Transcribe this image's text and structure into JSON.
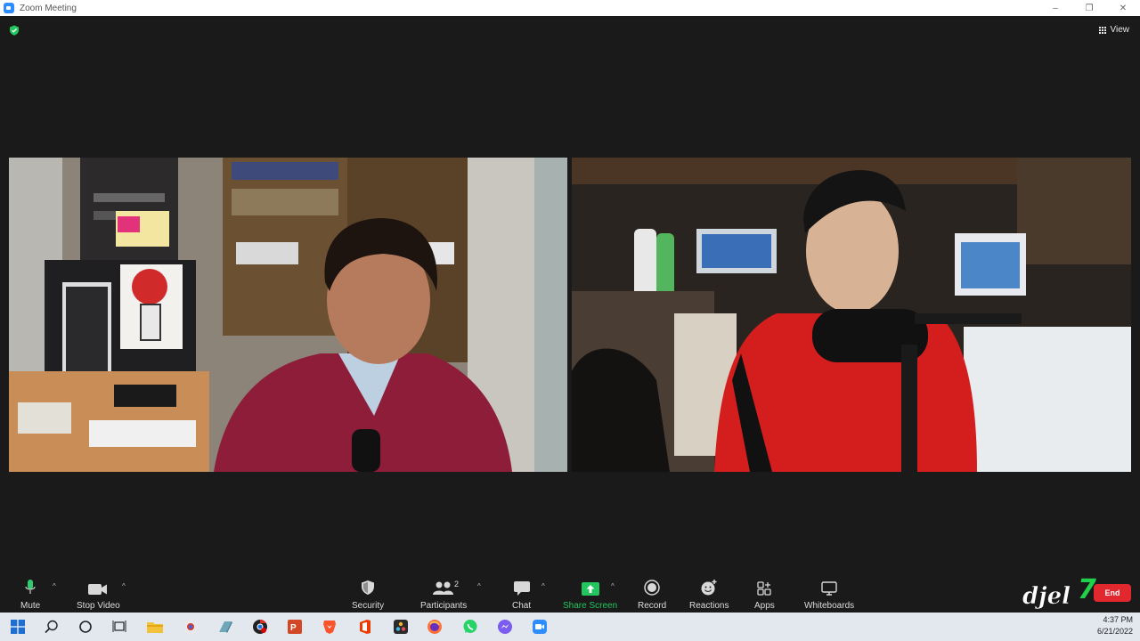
{
  "window": {
    "title": "Zoom Meeting",
    "controls": [
      "–",
      "❐",
      "✕"
    ]
  },
  "meeting": {
    "view_label": "View",
    "encryption": "shield-check-icon"
  },
  "toolbar": {
    "mute": "Mute",
    "stop_video": "Stop Video",
    "security": "Security",
    "participants": "Participants",
    "participants_count": "2",
    "chat": "Chat",
    "share_screen": "Share Screen",
    "record": "Record",
    "reactions": "Reactions",
    "apps": "Apps",
    "whiteboards": "Whiteboards",
    "end": "End"
  },
  "watermark": "djel7",
  "colors": {
    "accent_green": "#22c55e",
    "end_red": "#e0282e",
    "zoom_blue": "#2d8cff"
  },
  "taskbar": {
    "icons": [
      "windows-start-icon",
      "search-icon",
      "cortana-icon",
      "task-view-icon",
      "file-explorer-icon",
      "app-icon",
      "app-icon",
      "chrome-icon",
      "powerpoint-icon",
      "brave-icon",
      "office-icon",
      "davinci-icon",
      "firefox-icon",
      "whatsapp-icon",
      "messenger-icon",
      "zoom-icon"
    ],
    "time": "4:37 PM",
    "date": "6/21/2022"
  }
}
